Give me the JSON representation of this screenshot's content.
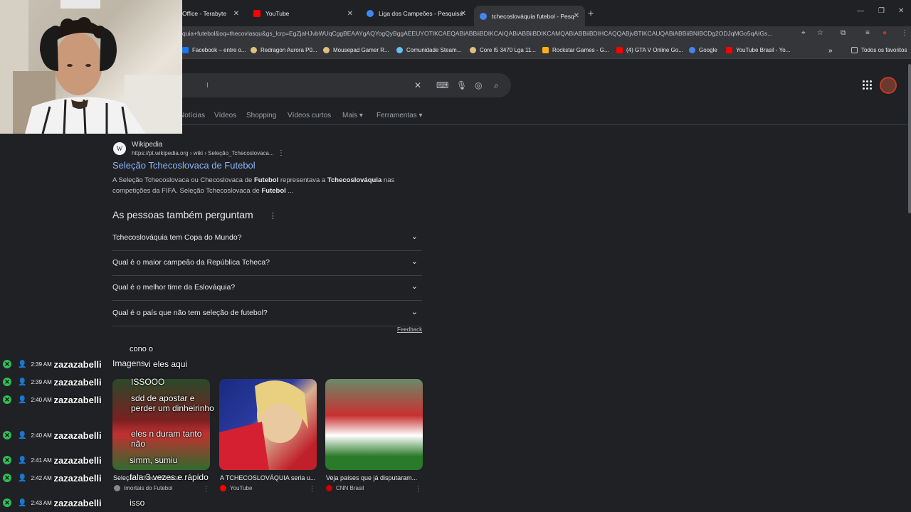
{
  "tabs": [
    {
      "label": "Office - Terabyte",
      "color": "#3c4043"
    },
    {
      "label": "YouTube",
      "color": "#ff0000"
    },
    {
      "label": "Liga dos Campeões - Pesquisa",
      "color": "#4285f4"
    },
    {
      "label": "tchecoslováquia futebol - Pesq",
      "color": "#4285f4"
    }
  ],
  "url": "quia+futebol&oq=thecovlasqu&gs_lcrp=EgZjaHJvbWUqCggBEAAYgAQYogQyBggAEEUYOTIKCAEQABiABBiiBDIKCAIQABiABBiiBDIKCAMQABiABBiiBDIHCAQQABjvBTIKCAUQABiABBiiBNIBCDg2ODJqMGo5qAIGs...",
  "bookmarks": [
    {
      "label": "Facebook – entre o...",
      "color": "#1877f2"
    },
    {
      "label": "Redragon Aurora P0...",
      "color": "#e0c080"
    },
    {
      "label": "Mousepad Gamer R...",
      "color": "#e0c080"
    },
    {
      "label": "Comunidade Steam...",
      "color": "#1b2838"
    },
    {
      "label": "Core I5 3470 Lga 11...",
      "color": "#e0c080"
    },
    {
      "label": "Rockstar Games - G...",
      "color": "#fcaf17"
    },
    {
      "label": "(4) GTA V Online Go...",
      "color": "#ff0000"
    },
    {
      "label": "Google",
      "color": "#4285f4"
    },
    {
      "label": "YouTube Brasil - Yo...",
      "color": "#ff0000"
    }
  ],
  "bookmarks_more": "»",
  "all_favorites": "Todos os favoritos",
  "navtabs": [
    "Notícias",
    "Vídeos",
    "Shopping",
    "Vídeos curtos",
    "Mais ▾",
    "Ferramentas ▾"
  ],
  "result": {
    "site": "Wikipedia",
    "logo": "W",
    "url": "https://pt.wikipedia.org › wiki › Seleção_Tchecoslovaca...",
    "title": "Seleção Tchecoslovaca de Futebol",
    "snippet_pre": "A Seleção Tchecoslovaca ou Checoslovaca de ",
    "snippet_b1": "Futebol",
    "snippet_mid": " representava a ",
    "snippet_b2": "Tchecoslováquia",
    "snippet_post": " nas competições da FIFA. Seleção Tchecoslovaca de ",
    "snippet_b3": "Futebol",
    "snippet_end": " ..."
  },
  "paa": {
    "title": "As pessoas também perguntam",
    "questions": [
      "Tchecoslováquia tem Copa do Mundo?",
      "Qual é o maior campeão da República Tcheca?",
      "Qual é o melhor time da Eslováquia?",
      "Qual é o país que não tem seleção de futebol?"
    ],
    "feedback": "Feedback"
  },
  "images": {
    "heading": "Imagens",
    "items": [
      {
        "caption": "Seleção Tchecoslovaca...",
        "source": "Imortais do Futebol",
        "favicon": "#888888"
      },
      {
        "caption": "A TCHECOSLOVÁQUIA seria u...",
        "source": "YouTube",
        "favicon": "#ff0000"
      },
      {
        "caption": "Veja países que já disputaram...",
        "source": "CNN Brasil",
        "favicon": "#cc0000"
      }
    ]
  },
  "chat": [
    {
      "time": "2:39 AM",
      "user": "zazazabelli",
      "msg": "vi eles aqui"
    },
    {
      "time": "2:39 AM",
      "user": "zazazabelli",
      "msg": "ISSOOO"
    },
    {
      "time": "2:40 AM",
      "user": "zazazabelli",
      "msg": "sdd de apostar e perder um dinheirinho"
    },
    {
      "time": "2:40 AM",
      "user": "zazazabelli",
      "msg": "eles n duram tanto não"
    },
    {
      "time": "2:41 AM",
      "user": "zazazabelli",
      "msg": "simm, sumiu"
    },
    {
      "time": "2:42 AM",
      "user": "zazazabelli",
      "msg": "fala 3 vezes e rápido"
    },
    {
      "time": "2:43 AM",
      "user": "zazazabelli",
      "msg": "isso"
    }
  ],
  "chat_partial_top": "cono o"
}
